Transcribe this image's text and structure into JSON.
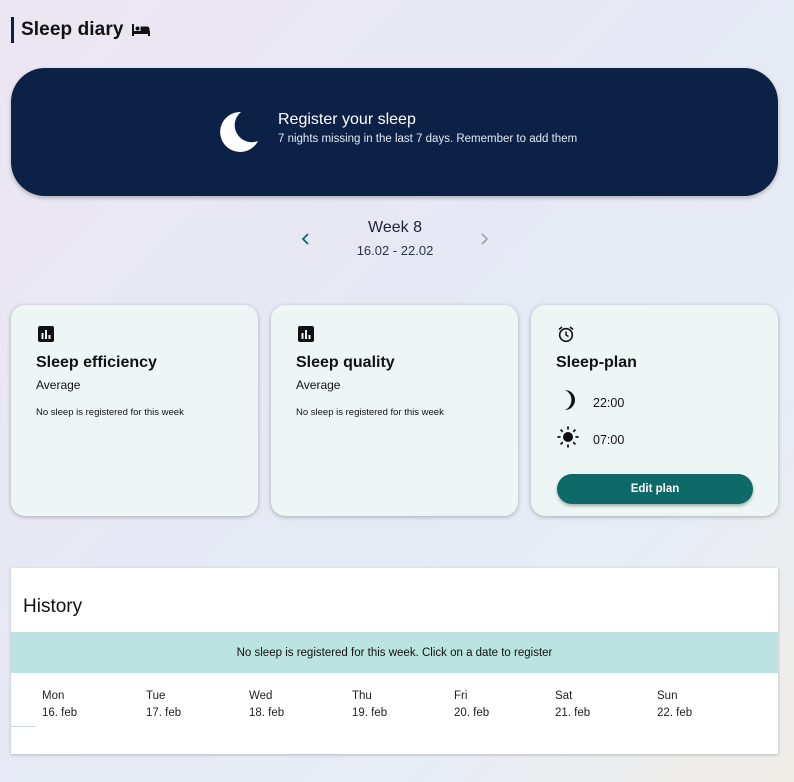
{
  "header": {
    "title": "Sleep diary",
    "icon": "bed-icon"
  },
  "banner": {
    "title": "Register your sleep",
    "subtitle": "7 nights missing in the last 7 days. Remember to add them",
    "icon": "moon-icon",
    "background": "#0c2146"
  },
  "week": {
    "title": "Week 8",
    "range": "16.02 - 22.02"
  },
  "cards": {
    "efficiency": {
      "title": "Sleep efficiency",
      "subtitle": "Average",
      "note": "No sleep is registered for this week",
      "icon": "bar-chart-icon"
    },
    "quality": {
      "title": "Sleep quality",
      "subtitle": "Average",
      "note": "No sleep is registered for this week",
      "icon": "bar-chart-icon"
    },
    "plan": {
      "title": "Sleep-plan",
      "bedtime": "22:00",
      "waketime": "07:00",
      "button_label": "Edit plan",
      "icon": "alarm-clock-icon"
    }
  },
  "history": {
    "title": "History",
    "banner": "No sleep is registered for this week. Click on a date to register",
    "days": [
      {
        "name": "Mon",
        "date": "16. feb"
      },
      {
        "name": "Tue",
        "date": "17. feb"
      },
      {
        "name": "Wed",
        "date": "18. feb"
      },
      {
        "name": "Thu",
        "date": "19. feb"
      },
      {
        "name": "Fri",
        "date": "20. feb"
      },
      {
        "name": "Sat",
        "date": "21. feb"
      },
      {
        "name": "Sun",
        "date": "22. feb"
      }
    ]
  },
  "colors": {
    "accent": "#0e6a69",
    "navy": "#0c2146",
    "card_bg": "#eef6f5",
    "history_banner": "#bae3e1"
  }
}
